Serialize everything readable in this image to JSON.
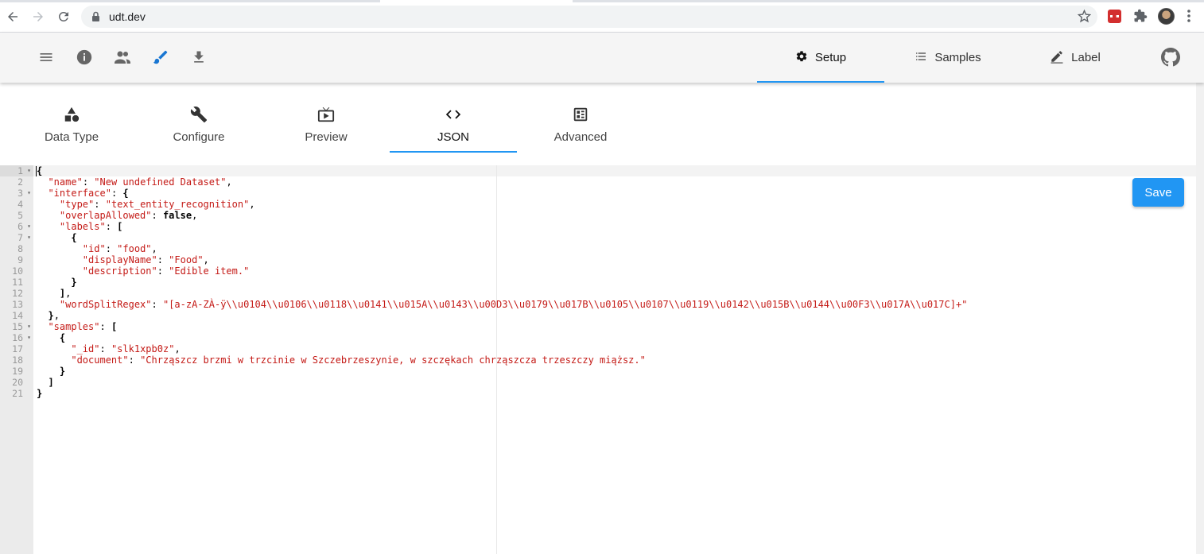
{
  "browser": {
    "url": "udt.dev"
  },
  "header": {
    "tabs": [
      {
        "label": "Setup",
        "icon": "gear-icon",
        "active": true
      },
      {
        "label": "Samples",
        "icon": "list-icon",
        "active": false
      },
      {
        "label": "Label",
        "icon": "pencil-icon",
        "active": false
      }
    ],
    "icons": [
      "menu-icon",
      "info-icon",
      "people-icon",
      "brush-icon",
      "download-icon",
      "github-icon"
    ]
  },
  "subtabs": [
    {
      "label": "Data Type",
      "icon": "shapes-icon"
    },
    {
      "label": "Configure",
      "icon": "wrench-icon"
    },
    {
      "label": "Preview",
      "icon": "tv-play-icon"
    },
    {
      "label": "JSON",
      "icon": "code-icon",
      "active": true
    },
    {
      "label": "Advanced",
      "icon": "dashboard-icon"
    }
  ],
  "editor": {
    "line_numbers": [
      "1",
      "2",
      "3",
      "4",
      "5",
      "6",
      "7",
      "8",
      "9",
      "10",
      "11",
      "12",
      "13",
      "14",
      "15",
      "16",
      "17",
      "18",
      "19",
      "20",
      "21"
    ],
    "json": {
      "name": "New undefined Dataset",
      "type": "text_entity_recognition",
      "overlapAllowed": "false",
      "label_id": "food",
      "label_displayName": "Food",
      "label_description": "Edible item.",
      "wordSplitRegex": "[a-zA-ZÀ-ÿ\\\\u0104\\\\u0106\\\\u0118\\\\u0141\\\\u015A\\\\u0143\\\\u00D3\\\\u0179\\\\u017B\\\\u0105\\\\u0107\\\\u0119\\\\u0142\\\\u015B\\\\u0144\\\\u00F3\\\\u017A\\\\u017C]+",
      "sample_id": "slk1xpb0z",
      "sample_document": "Chrząszcz brzmi w trzcinie w Szczebrzeszynie, w szczękach chrząszcza trzeszczy miąższ."
    }
  },
  "save_label": "Save"
}
